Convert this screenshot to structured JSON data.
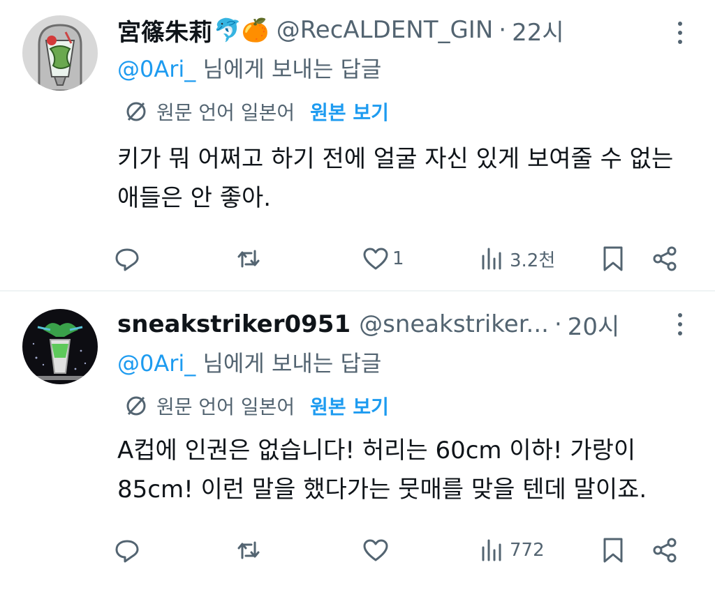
{
  "tweets": [
    {
      "name": "宮篠朱莉",
      "emojis": "🐬🍊",
      "handle": "@RecALDENT_GIN",
      "separator": "·",
      "time": "22시",
      "reply_mention": "@0Ari_",
      "reply_suffix": " 님에게 보내는 답글",
      "translate_lang": "원문 언어 일본어",
      "translate_show": "원본 보기",
      "text": "키가 뭐 어쩌고 하기 전에 얼굴 자신 있게 보여줄 수 없는 애들은 안 좋아.",
      "actions": {
        "replies": "",
        "retweets": "",
        "likes": "1",
        "views": "3.2천"
      }
    },
    {
      "name": "sneakstriker0951",
      "emojis": "",
      "handle": "@sneakstriker...",
      "separator": "·",
      "time": "20시",
      "reply_mention": "@0Ari_",
      "reply_suffix": " 님에게 보내는 답글",
      "translate_lang": "원문 언어 일본어",
      "translate_show": "원본 보기",
      "text": "A컵에 인권은 없습니다! 허리는 60cm 이하! 가랑이 85cm! 이런 말을 했다가는 뭇매를 맞을 텐데 말이죠.",
      "actions": {
        "replies": "",
        "retweets": "",
        "likes": "",
        "views": "772"
      }
    }
  ],
  "icons": {
    "reply": "reply-icon",
    "retweet": "retweet-icon",
    "like": "like-icon",
    "views": "views-icon",
    "bookmark": "bookmark-icon",
    "share": "share-icon",
    "more": "more-icon",
    "translate": "translate-icon"
  },
  "colors": {
    "accent": "#1d9bf0",
    "secondary": "#536471",
    "text": "#0f1419",
    "divider": "#eff3f4"
  }
}
